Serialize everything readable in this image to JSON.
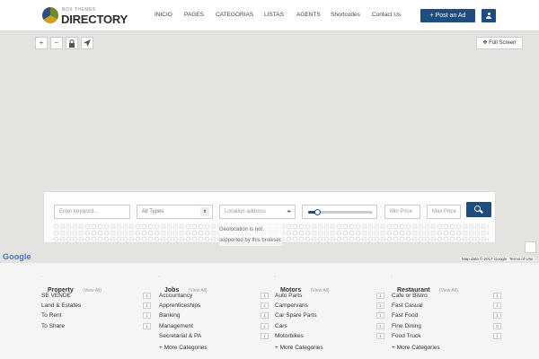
{
  "header": {
    "logo_small": "BOX THEMES",
    "logo_big": "DIRECTORY",
    "nav": [
      "INICIO",
      "PAGES",
      "CATEGORIAS",
      "LISTAS",
      "AGENTS",
      "Shortcodes",
      "Contact Us"
    ],
    "post_ad": "Post an Ad",
    "post_ad_icon": "+"
  },
  "map": {
    "zoom_in": "+",
    "zoom_out": "−",
    "fullscreen": "Full Screen",
    "fullscreen_icon": "✥",
    "google": "Google",
    "map_data": "Map data © 2017 Google",
    "terms": "Terms of Use"
  },
  "search": {
    "keyword_placeholder": "Enter keyword...",
    "type_value": "All Types",
    "location_placeholder": "Location address",
    "price_slider": 0.15,
    "min_price": "Min Price",
    "max_price": "Max Price",
    "geo_line1": "Geolocation is not",
    "geo_line2": "supported by this browser."
  },
  "categories": [
    {
      "title": "Property",
      "view_all": "(View All)",
      "items": [
        {
          "name": "SE VENDE",
          "count": "1"
        },
        {
          "name": "Land & Estates",
          "count": "1"
        },
        {
          "name": "To Rent",
          "count": "1"
        },
        {
          "name": "To Share",
          "count": "1"
        }
      ]
    },
    {
      "title": "Jobs",
      "view_all": "(View All)",
      "items": [
        {
          "name": "Accountancy",
          "count": "1"
        },
        {
          "name": "Apprenticeships",
          "count": "1"
        },
        {
          "name": "Banking",
          "count": "1"
        },
        {
          "name": "Management",
          "count": "1"
        },
        {
          "name": "Secretarial & PA",
          "count": "1"
        }
      ],
      "more": "More Categories"
    },
    {
      "title": "Motors",
      "view_all": "(View All)",
      "items": [
        {
          "name": "Auto Parts",
          "count": "1"
        },
        {
          "name": "Campervans",
          "count": "1"
        },
        {
          "name": "Car Spare Parts",
          "count": "1"
        },
        {
          "name": "Cars",
          "count": "1"
        },
        {
          "name": "Motorbikes",
          "count": "1"
        }
      ],
      "more": "More Categories"
    },
    {
      "title": "Restaurant",
      "view_all": "(View All)",
      "items": [
        {
          "name": "Cafe or Bistro",
          "count": "1"
        },
        {
          "name": "Fast Casual",
          "count": "1"
        },
        {
          "name": "Fast Food",
          "count": "1"
        },
        {
          "name": "Fine Dining",
          "count": "0"
        },
        {
          "name": "Food Truck",
          "count": "1"
        }
      ],
      "more": "More Categories"
    }
  ]
}
